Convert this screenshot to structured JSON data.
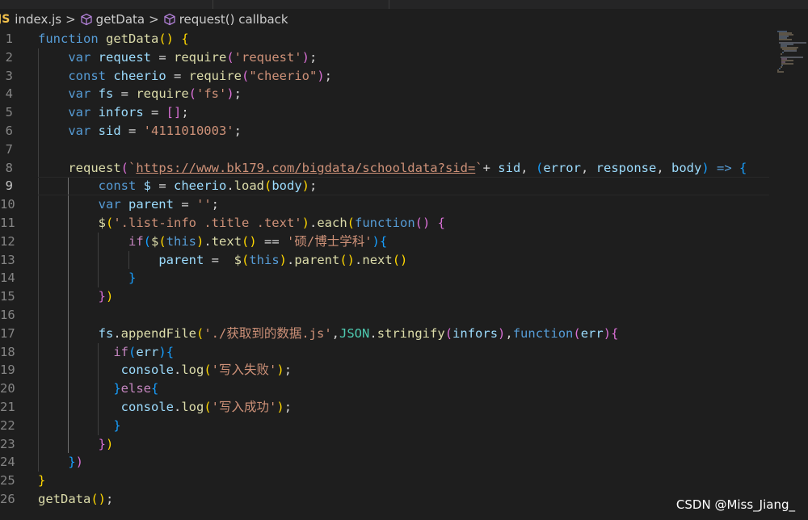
{
  "breadcrumb": {
    "items": [
      {
        "label": "index.js",
        "icon": "js-file-icon"
      },
      {
        "label": "getData",
        "icon": "method-cube-icon"
      },
      {
        "label": "request() callback",
        "icon": "method-cube-icon"
      }
    ],
    "separator": ">"
  },
  "editor": {
    "active_line": 9,
    "lines": [
      {
        "n": "1",
        "tokens": [
          [
            "kw",
            "function "
          ],
          [
            "fn",
            "getData"
          ],
          [
            "b1",
            "()"
          ],
          [
            "pl",
            " "
          ],
          [
            "b1",
            "{"
          ]
        ]
      },
      {
        "n": "2",
        "tokens": [
          [
            "pl",
            "    "
          ],
          [
            "kw",
            "var "
          ],
          [
            "var",
            "request"
          ],
          [
            "pl",
            " = "
          ],
          [
            "fn",
            "require"
          ],
          [
            "b2",
            "("
          ],
          [
            "str",
            "'request'"
          ],
          [
            "b2",
            ")"
          ],
          [
            "pl",
            ";"
          ]
        ]
      },
      {
        "n": "3",
        "tokens": [
          [
            "pl",
            "    "
          ],
          [
            "kw",
            "const "
          ],
          [
            "var",
            "cheerio"
          ],
          [
            "pl",
            " = "
          ],
          [
            "fn",
            "require"
          ],
          [
            "b2",
            "("
          ],
          [
            "str",
            "\"cheerio\""
          ],
          [
            "b2",
            ")"
          ],
          [
            "pl",
            ";"
          ]
        ]
      },
      {
        "n": "4",
        "tokens": [
          [
            "pl",
            "    "
          ],
          [
            "kw",
            "var "
          ],
          [
            "var",
            "fs"
          ],
          [
            "pl",
            " = "
          ],
          [
            "fn",
            "require"
          ],
          [
            "b2",
            "("
          ],
          [
            "str",
            "'fs'"
          ],
          [
            "b2",
            ")"
          ],
          [
            "pl",
            ";"
          ]
        ]
      },
      {
        "n": "5",
        "tokens": [
          [
            "pl",
            "    "
          ],
          [
            "kw",
            "var "
          ],
          [
            "var",
            "infors"
          ],
          [
            "pl",
            " = "
          ],
          [
            "b2",
            "[]"
          ],
          [
            "pl",
            ";"
          ]
        ]
      },
      {
        "n": "6",
        "tokens": [
          [
            "pl",
            "    "
          ],
          [
            "kw",
            "var "
          ],
          [
            "var",
            "sid"
          ],
          [
            "pl",
            " = "
          ],
          [
            "str",
            "'4111010003'"
          ],
          [
            "pl",
            ";"
          ]
        ]
      },
      {
        "n": "7",
        "tokens": []
      },
      {
        "n": "8",
        "tokens": [
          [
            "pl",
            "    "
          ],
          [
            "fn",
            "request"
          ],
          [
            "b2",
            "("
          ],
          [
            "str",
            "`"
          ],
          [
            "str url",
            "https://www.bk179.com/bigdata/schooldata?sid="
          ],
          [
            "str",
            "`"
          ],
          [
            "pl",
            "+ "
          ],
          [
            "var",
            "sid"
          ],
          [
            "pl",
            ", "
          ],
          [
            "b3",
            "("
          ],
          [
            "var",
            "error"
          ],
          [
            "pl",
            ", "
          ],
          [
            "var",
            "response"
          ],
          [
            "pl",
            ", "
          ],
          [
            "var",
            "body"
          ],
          [
            "b3",
            ")"
          ],
          [
            "pl",
            " "
          ],
          [
            "kw",
            "=>"
          ],
          [
            "pl",
            " "
          ],
          [
            "b3",
            "{"
          ]
        ]
      },
      {
        "n": "9",
        "tokens": [
          [
            "pl",
            "        "
          ],
          [
            "kw",
            "const "
          ],
          [
            "var",
            "$"
          ],
          [
            "pl",
            " = "
          ],
          [
            "var",
            "cheerio"
          ],
          [
            "pl",
            "."
          ],
          [
            "fn",
            "load"
          ],
          [
            "b1",
            "("
          ],
          [
            "var",
            "body"
          ],
          [
            "b1",
            ")"
          ],
          [
            "pl",
            ";"
          ]
        ]
      },
      {
        "n": "10",
        "tokens": [
          [
            "pl",
            "        "
          ],
          [
            "kw",
            "var "
          ],
          [
            "var",
            "parent"
          ],
          [
            "pl",
            " = "
          ],
          [
            "str",
            "''"
          ],
          [
            "pl",
            ";"
          ]
        ]
      },
      {
        "n": "11",
        "tokens": [
          [
            "pl",
            "        "
          ],
          [
            "fn",
            "$"
          ],
          [
            "b1",
            "("
          ],
          [
            "str",
            "'.list-info .title .text'"
          ],
          [
            "b1",
            ")"
          ],
          [
            "pl",
            "."
          ],
          [
            "fn",
            "each"
          ],
          [
            "b1",
            "("
          ],
          [
            "kw",
            "function"
          ],
          [
            "b2",
            "()"
          ],
          [
            "pl",
            " "
          ],
          [
            "b2",
            "{"
          ]
        ]
      },
      {
        "n": "12",
        "tokens": [
          [
            "pl",
            "            "
          ],
          [
            "kw2",
            "if"
          ],
          [
            "b3",
            "("
          ],
          [
            "fn",
            "$"
          ],
          [
            "b1",
            "("
          ],
          [
            "kw",
            "this"
          ],
          [
            "b1",
            ")"
          ],
          [
            "pl",
            "."
          ],
          [
            "fn",
            "text"
          ],
          [
            "b1",
            "()"
          ],
          [
            "pl",
            " == "
          ],
          [
            "str",
            "'硕/博士学科'"
          ],
          [
            "b3",
            ")"
          ],
          [
            "b3",
            "{"
          ]
        ]
      },
      {
        "n": "13",
        "tokens": [
          [
            "pl",
            "                "
          ],
          [
            "var",
            "parent"
          ],
          [
            "pl",
            " =  "
          ],
          [
            "fn",
            "$"
          ],
          [
            "b1",
            "("
          ],
          [
            "kw",
            "this"
          ],
          [
            "b1",
            ")"
          ],
          [
            "pl",
            "."
          ],
          [
            "fn",
            "parent"
          ],
          [
            "b1",
            "()"
          ],
          [
            "pl",
            "."
          ],
          [
            "fn",
            "next"
          ],
          [
            "b1",
            "()"
          ]
        ]
      },
      {
        "n": "14",
        "tokens": [
          [
            "pl",
            "            "
          ],
          [
            "b3",
            "}"
          ]
        ]
      },
      {
        "n": "15",
        "tokens": [
          [
            "pl",
            "        "
          ],
          [
            "b2",
            "}"
          ],
          [
            "b1",
            ")"
          ]
        ]
      },
      {
        "n": "16",
        "tokens": []
      },
      {
        "n": "17",
        "tokens": [
          [
            "pl",
            "        "
          ],
          [
            "var",
            "fs"
          ],
          [
            "pl",
            "."
          ],
          [
            "fn",
            "appendFile"
          ],
          [
            "b1",
            "("
          ],
          [
            "str",
            "'./获取到的数据.js'"
          ],
          [
            "pl",
            ","
          ],
          [
            "cls",
            "JSON"
          ],
          [
            "pl",
            "."
          ],
          [
            "fn",
            "stringify"
          ],
          [
            "b2",
            "("
          ],
          [
            "var",
            "infors"
          ],
          [
            "b2",
            ")"
          ],
          [
            "pl",
            ","
          ],
          [
            "kw",
            "function"
          ],
          [
            "b2",
            "("
          ],
          [
            "var",
            "err"
          ],
          [
            "b2",
            ")"
          ],
          [
            "b2",
            "{"
          ]
        ]
      },
      {
        "n": "18",
        "tokens": [
          [
            "pl",
            "          "
          ],
          [
            "kw2",
            "if"
          ],
          [
            "b3",
            "("
          ],
          [
            "var",
            "err"
          ],
          [
            "b3",
            ")"
          ],
          [
            "b3",
            "{"
          ]
        ]
      },
      {
        "n": "19",
        "tokens": [
          [
            "pl",
            "           "
          ],
          [
            "var",
            "console"
          ],
          [
            "pl",
            "."
          ],
          [
            "fn",
            "log"
          ],
          [
            "b1",
            "("
          ],
          [
            "str",
            "'写入失败'"
          ],
          [
            "b1",
            ")"
          ],
          [
            "pl",
            ";"
          ]
        ]
      },
      {
        "n": "20",
        "tokens": [
          [
            "pl",
            "          "
          ],
          [
            "b3",
            "}"
          ],
          [
            "kw2",
            "else"
          ],
          [
            "b3",
            "{"
          ]
        ]
      },
      {
        "n": "21",
        "tokens": [
          [
            "pl",
            "           "
          ],
          [
            "var",
            "console"
          ],
          [
            "pl",
            "."
          ],
          [
            "fn",
            "log"
          ],
          [
            "b1",
            "("
          ],
          [
            "str",
            "'写入成功'"
          ],
          [
            "b1",
            ")"
          ],
          [
            "pl",
            ";"
          ]
        ]
      },
      {
        "n": "22",
        "tokens": [
          [
            "pl",
            "          "
          ],
          [
            "b3",
            "}"
          ]
        ]
      },
      {
        "n": "23",
        "tokens": [
          [
            "pl",
            "        "
          ],
          [
            "b2",
            "}"
          ],
          [
            "b1",
            ")"
          ]
        ]
      },
      {
        "n": "24",
        "tokens": [
          [
            "pl",
            "    "
          ],
          [
            "b3",
            "}"
          ],
          [
            "b2",
            ")"
          ]
        ]
      },
      {
        "n": "25",
        "tokens": [
          [
            "b1",
            "}"
          ]
        ]
      },
      {
        "n": "26",
        "tokens": [
          [
            "fn",
            "getData"
          ],
          [
            "b1",
            "()"
          ],
          [
            "pl",
            ";"
          ]
        ]
      }
    ]
  },
  "watermark": "CSDN @Miss_Jiang_",
  "colors": {
    "background": "#1e1e1e",
    "keyword": "#569cd6",
    "control": "#c586c0",
    "function": "#dcdcaa",
    "string": "#ce9178",
    "variable": "#9cdcfe"
  }
}
